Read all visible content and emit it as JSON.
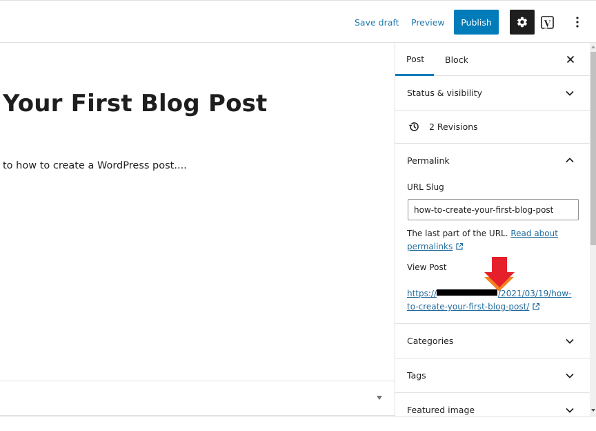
{
  "topbar": {
    "save_draft": "Save draft",
    "preview": "Preview",
    "publish": "Publish",
    "settings_icon": "gear-icon",
    "yoast_icon": "yoast-icon",
    "yoast_glyph": "y",
    "more_icon": "more-vertical-icon"
  },
  "editor": {
    "title": "Your First Blog Post",
    "paragraph": "to how to create a WordPress post...."
  },
  "sidebar": {
    "tabs": [
      {
        "label": "Post",
        "active": true
      },
      {
        "label": "Block",
        "active": false
      }
    ],
    "close_icon": "close-icon",
    "panels": {
      "status": {
        "label": "Status & visibility",
        "expanded": false
      },
      "revisions": {
        "label": "2 Revisions",
        "icon": "history-icon"
      },
      "permalink": {
        "label": "Permalink",
        "expanded": true,
        "url_slug_label": "URL Slug",
        "url_slug_value": "how-to-create-your-first-blog-post",
        "help_text": "The last part of the URL.",
        "help_link": "Read about permalinks",
        "view_post_label": "View Post",
        "view_url_prefix": "https://",
        "view_url_suffix": "/2021/03/19/how-to-create-your-first-blog-post/"
      },
      "categories": {
        "label": "Categories",
        "expanded": false
      },
      "tags": {
        "label": "Tags",
        "expanded": false
      },
      "featured": {
        "label": "Featured image",
        "expanded": false
      }
    }
  },
  "annotation": {
    "arrow_color": "#e5202a",
    "arrow_shadow_color": "#f58220"
  },
  "colors": {
    "accent": "#007cba",
    "link": "#1f6a9c",
    "dark_button": "#1e1e1e"
  }
}
